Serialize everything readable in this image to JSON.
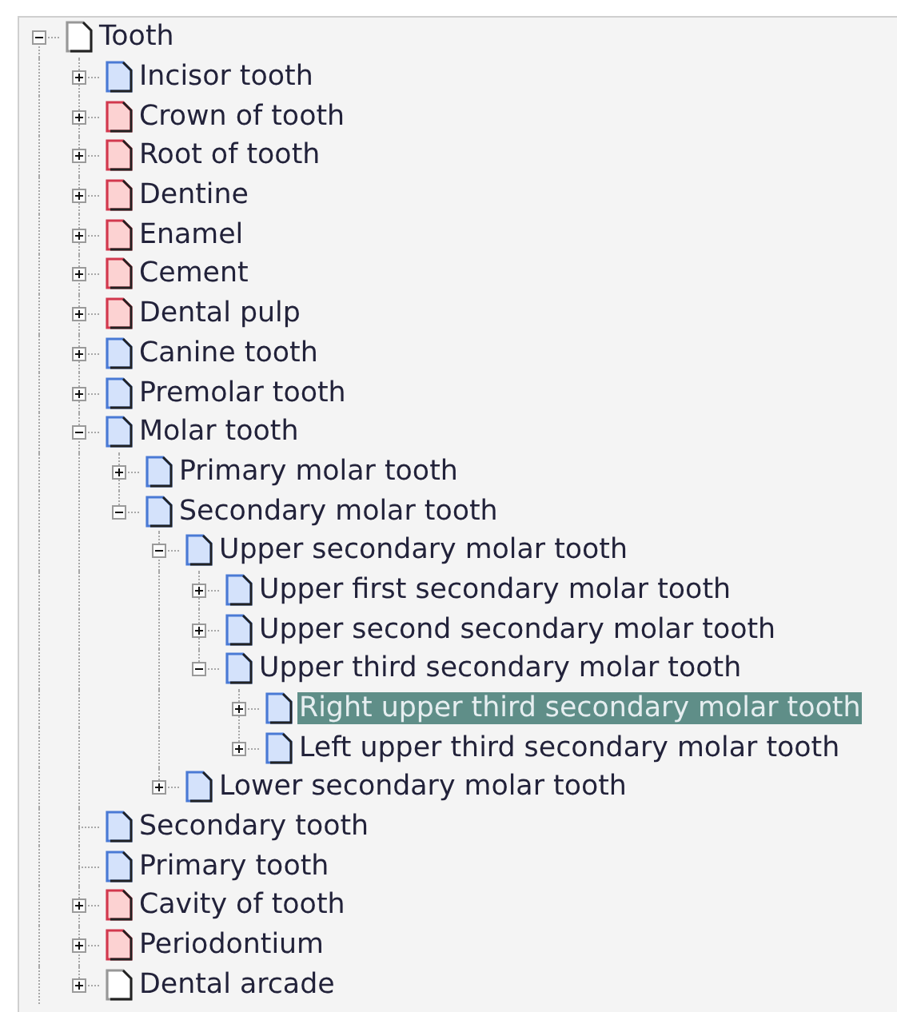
{
  "tree": [
    {
      "label": "Tooth",
      "kind": "branch",
      "expanded": true,
      "selected": false,
      "color": "#ffffff",
      "children": [
        {
          "label": "Incisor tooth",
          "kind": "branch",
          "expanded": false,
          "selected": false,
          "color": "#d4e2fb"
        },
        {
          "label": "Crown of tooth",
          "kind": "branch",
          "expanded": false,
          "selected": false,
          "color": "#fcd2d2"
        },
        {
          "label": "Root of tooth",
          "kind": "branch",
          "expanded": false,
          "selected": false,
          "color": "#fcd2d2"
        },
        {
          "label": "Dentine",
          "kind": "branch",
          "expanded": false,
          "selected": false,
          "color": "#fcd2d2"
        },
        {
          "label": "Enamel",
          "kind": "branch",
          "expanded": false,
          "selected": false,
          "color": "#fcd2d2"
        },
        {
          "label": "Cement",
          "kind": "branch",
          "expanded": false,
          "selected": false,
          "color": "#fcd2d2"
        },
        {
          "label": "Dental pulp",
          "kind": "branch",
          "expanded": false,
          "selected": false,
          "color": "#fcd2d2"
        },
        {
          "label": "Canine tooth",
          "kind": "branch",
          "expanded": false,
          "selected": false,
          "color": "#d4e2fb"
        },
        {
          "label": "Premolar tooth",
          "kind": "branch",
          "expanded": false,
          "selected": false,
          "color": "#d4e2fb"
        },
        {
          "label": "Molar tooth",
          "kind": "branch",
          "expanded": true,
          "selected": false,
          "color": "#d4e2fb",
          "children": [
            {
              "label": "Primary molar tooth",
              "kind": "branch",
              "expanded": false,
              "selected": false,
              "color": "#d4e2fb"
            },
            {
              "label": "Secondary molar tooth",
              "kind": "branch",
              "expanded": true,
              "selected": false,
              "color": "#d4e2fb",
              "children": [
                {
                  "label": "Upper secondary molar tooth",
                  "kind": "branch",
                  "expanded": true,
                  "selected": false,
                  "color": "#d4e2fb",
                  "children": [
                    {
                      "label": "Upper first secondary molar tooth",
                      "kind": "branch",
                      "expanded": false,
                      "selected": false,
                      "color": "#d4e2fb"
                    },
                    {
                      "label": "Upper second secondary molar tooth",
                      "kind": "branch",
                      "expanded": false,
                      "selected": false,
                      "color": "#d4e2fb"
                    },
                    {
                      "label": "Upper third secondary molar tooth",
                      "kind": "branch",
                      "expanded": true,
                      "selected": false,
                      "color": "#d4e2fb",
                      "children": [
                        {
                          "label": "Right upper third secondary molar tooth",
                          "kind": "branch",
                          "expanded": false,
                          "selected": true,
                          "color": "#d4e2fb"
                        },
                        {
                          "label": "Left upper third secondary molar tooth",
                          "kind": "branch",
                          "expanded": false,
                          "selected": false,
                          "color": "#d4e2fb"
                        }
                      ]
                    }
                  ]
                },
                {
                  "label": "Lower secondary molar tooth",
                  "kind": "branch",
                  "expanded": false,
                  "selected": false,
                  "color": "#d4e2fb"
                }
              ]
            }
          ]
        },
        {
          "label": "Secondary tooth",
          "kind": "leaf",
          "selected": false,
          "color": "#d4e2fb"
        },
        {
          "label": "Primary tooth",
          "kind": "leaf",
          "selected": false,
          "color": "#d4e2fb"
        },
        {
          "label": "Cavity of tooth",
          "kind": "branch",
          "expanded": false,
          "selected": false,
          "color": "#fcd2d2"
        },
        {
          "label": "Periodontium",
          "kind": "branch",
          "expanded": false,
          "selected": false,
          "color": "#fcd2d2"
        },
        {
          "label": "Dental arcade",
          "kind": "branch",
          "expanded": false,
          "selected": false,
          "color": "#ffffff"
        }
      ]
    }
  ]
}
